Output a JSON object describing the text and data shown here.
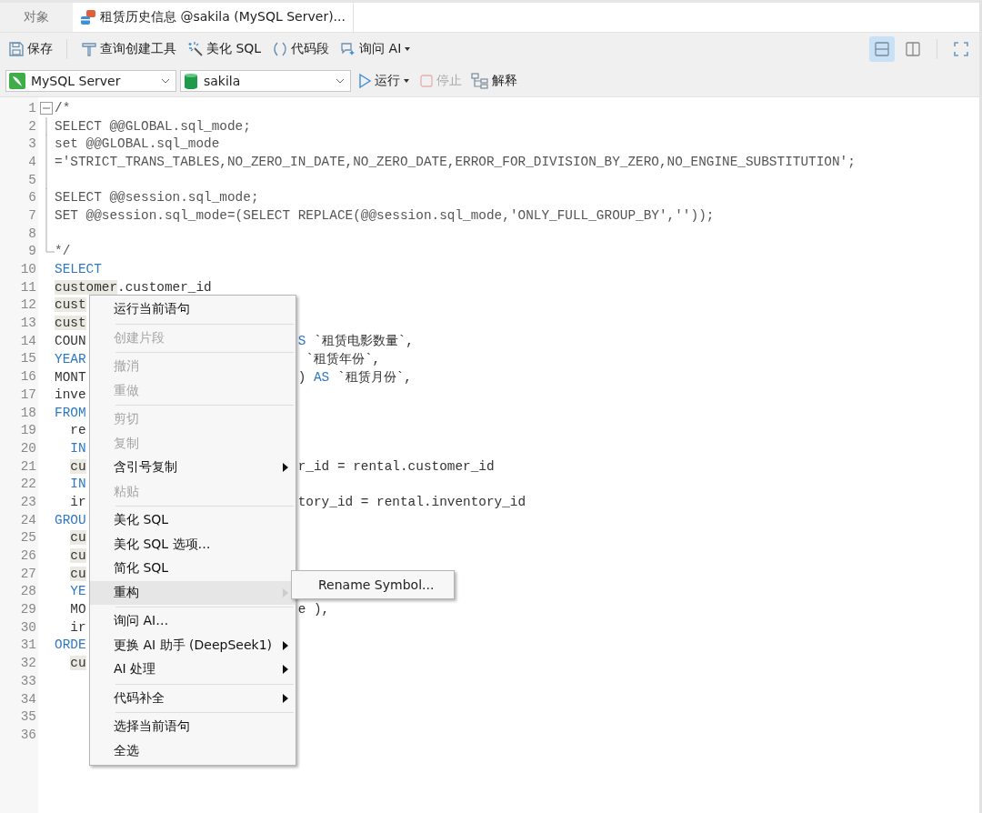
{
  "tabs": [
    {
      "kind": "objects",
      "label": "对象",
      "selected": false
    },
    {
      "kind": "query",
      "label": "租赁历史信息 @sakila (MySQL Server)...",
      "selected": true
    }
  ],
  "toolbar": [
    {
      "kind": "save",
      "label": "保存",
      "dropdown": false
    },
    {
      "kind": "query-builder",
      "label": "查询创建工具",
      "dropdown": false
    },
    {
      "kind": "beautify",
      "label": "美化 SQL",
      "dropdown": false
    },
    {
      "kind": "snippet",
      "label": "代码段",
      "dropdown": false
    },
    {
      "kind": "ask-ai",
      "label": "询问 AI",
      "dropdown": true
    }
  ],
  "view_buttons": [
    {
      "kind": "split-horizontal",
      "selected": true
    },
    {
      "kind": "split-vertical",
      "selected": false
    },
    {
      "kind": "fullscreen",
      "selected": false
    }
  ],
  "connection": {
    "value": "MySQL Server"
  },
  "database": {
    "value": "sakila"
  },
  "run_bar": [
    {
      "kind": "run",
      "label": "运行",
      "dropdown": true,
      "disabled": false
    },
    {
      "kind": "stop",
      "label": "停止",
      "dropdown": false,
      "disabled": true
    },
    {
      "kind": "explain",
      "label": "解释",
      "dropdown": false,
      "disabled": false
    }
  ],
  "editor": {
    "lines": [
      {
        "number": "1",
        "indent": false,
        "fold": {
          "kind": "start"
        },
        "code": [
          {
            "kind": "comment",
            "text": "/*"
          }
        ]
      },
      {
        "number": "2",
        "indent": false,
        "fold": {
          "kind": "middle"
        },
        "code": [
          {
            "kind": "comment",
            "text": "SELECT @@GLOBAL.sql_mode;"
          }
        ]
      },
      {
        "number": "3",
        "indent": false,
        "fold": {
          "kind": "middle"
        },
        "code": [
          {
            "kind": "comment",
            "text": "set @@GLOBAL.sql_mode"
          }
        ]
      },
      {
        "number": "4",
        "indent": false,
        "fold": {
          "kind": "middle"
        },
        "code": [
          {
            "kind": "comment",
            "text": "='STRICT_TRANS_TABLES,NO_ZERO_IN_DATE,NO_ZERO_DATE,ERROR_FOR_DIVISION_BY_ZERO,NO_ENGINE_SUBSTITUTION';"
          }
        ]
      },
      {
        "number": "5",
        "fold": {
          "kind": "middle"
        }
      },
      {
        "number": "6",
        "indent": false,
        "fold": {
          "kind": "middle"
        },
        "code": [
          {
            "kind": "comment",
            "text": "SELECT @@session.sql_mode;"
          }
        ]
      },
      {
        "number": "7",
        "indent": false,
        "fold": {
          "kind": "middle"
        },
        "code": [
          {
            "kind": "comment",
            "text": "SET @@session.sql_mode=(SELECT REPLACE(@@session.sql_mode,'ONLY_FULL_GROUP_BY',''));"
          }
        ]
      },
      {
        "number": "8",
        "fold": {
          "kind": "middle"
        }
      },
      {
        "number": "9",
        "indent": false,
        "fold": {
          "kind": "end"
        },
        "code": [
          {
            "kind": "comment",
            "text": "*/"
          }
        ]
      },
      {
        "number": "10",
        "indent": false,
        "code": [
          {
            "kind": "keyword",
            "text": "SELECT"
          }
        ]
      },
      {
        "number": "11",
        "indent": false,
        "code": [
          {
            "kind": "match",
            "text": "customer"
          },
          {
            "kind": "plain",
            "text": ".customer_id"
          }
        ]
      },
      {
        "number": "12",
        "indent": false,
        "code": [
          {
            "kind": "match",
            "text": "cust"
          }
        ]
      },
      {
        "number": "13",
        "indent": false,
        "code": [
          {
            "kind": "match",
            "text": "cust"
          }
        ]
      },
      {
        "number": "14",
        "indent": false,
        "code": [
          {
            "kind": "plain",
            "text": "COUN"
          }
        ],
        "tail": [
          {
            "kind": "keyword",
            "text": "S"
          },
          {
            "kind": "plain",
            "text": " `租赁电影数量`,"
          }
        ]
      },
      {
        "number": "15",
        "indent": false,
        "code": [
          {
            "kind": "keyword",
            "text": "YEAR"
          }
        ],
        "tail": [
          {
            "kind": "plain",
            "text": " `租赁年份`,"
          }
        ]
      },
      {
        "number": "16",
        "indent": false,
        "code": [
          {
            "kind": "plain",
            "text": "MONT"
          }
        ],
        "tail": [
          {
            "kind": "plain",
            "text": ") "
          },
          {
            "kind": "keyword",
            "text": "AS"
          },
          {
            "kind": "plain",
            "text": " `租赁月份`,"
          }
        ]
      },
      {
        "number": "17",
        "indent": false,
        "code": [
          {
            "kind": "plain",
            "text": "inve"
          }
        ]
      },
      {
        "number": "18",
        "indent": false,
        "code": [
          {
            "kind": "keyword",
            "text": "FROM"
          }
        ]
      },
      {
        "number": "19",
        "indent": true,
        "code": [
          {
            "kind": "plain",
            "text": "re"
          }
        ]
      },
      {
        "number": "20",
        "indent": true,
        "code": [
          {
            "kind": "keyword",
            "text": "IN"
          }
        ]
      },
      {
        "number": "21",
        "indent": true,
        "code": [
          {
            "kind": "match",
            "text": "cu"
          }
        ],
        "tail": [
          {
            "kind": "plain",
            "text": "r_id = rental.customer_id"
          }
        ]
      },
      {
        "number": "22",
        "indent": true,
        "code": [
          {
            "kind": "keyword",
            "text": "IN"
          }
        ]
      },
      {
        "number": "23",
        "indent": true,
        "code": [
          {
            "kind": "plain",
            "text": "ir"
          }
        ],
        "tail": [
          {
            "kind": "plain",
            "text": "tory_id = rental.inventory_id"
          }
        ]
      },
      {
        "number": "24",
        "indent": false,
        "code": [
          {
            "kind": "keyword",
            "text": "GROU"
          }
        ]
      },
      {
        "number": "25",
        "indent": true,
        "code": [
          {
            "kind": "match",
            "text": "cu"
          }
        ]
      },
      {
        "number": "26",
        "indent": true,
        "code": [
          {
            "kind": "match",
            "text": "cu"
          }
        ]
      },
      {
        "number": "27",
        "indent": true,
        "code": [
          {
            "kind": "match",
            "text": "cu"
          }
        ]
      },
      {
        "number": "28",
        "indent": true,
        "code": [
          {
            "kind": "keyword",
            "text": "YE"
          }
        ]
      },
      {
        "number": "29",
        "indent": true,
        "code": [
          {
            "kind": "plain",
            "text": "MO"
          }
        ],
        "tail": [
          {
            "kind": "plain",
            "text": "e ),"
          }
        ]
      },
      {
        "number": "30",
        "indent": true,
        "code": [
          {
            "kind": "plain",
            "text": "ir"
          }
        ]
      },
      {
        "number": "31",
        "indent": false,
        "code": [
          {
            "kind": "keyword",
            "text": "ORDE"
          }
        ]
      },
      {
        "number": "32",
        "indent": true,
        "code": [
          {
            "kind": "match",
            "text": "cu"
          }
        ]
      },
      {
        "number": "33"
      },
      {
        "number": "34"
      },
      {
        "number": "35"
      },
      {
        "number": "36"
      }
    ]
  },
  "context_menu": {
    "items": [
      {
        "kind": "item",
        "label": "运行当前语句",
        "disabled": false,
        "submenu": false,
        "selected": false
      },
      {
        "kind": "separator"
      },
      {
        "kind": "item",
        "label": "创建片段",
        "disabled": true,
        "submenu": false,
        "selected": false
      },
      {
        "kind": "separator"
      },
      {
        "kind": "item",
        "label": "撤消",
        "disabled": true,
        "submenu": false,
        "selected": false
      },
      {
        "kind": "item",
        "label": "重做",
        "disabled": true,
        "submenu": false,
        "selected": false
      },
      {
        "kind": "separator"
      },
      {
        "kind": "item",
        "label": "剪切",
        "disabled": true,
        "submenu": false,
        "selected": false
      },
      {
        "kind": "item",
        "label": "复制",
        "disabled": true,
        "submenu": false,
        "selected": false
      },
      {
        "kind": "item",
        "label": "含引号复制",
        "disabled": false,
        "submenu": true,
        "selected": false
      },
      {
        "kind": "item",
        "label": "粘贴",
        "disabled": true,
        "submenu": false,
        "selected": false
      },
      {
        "kind": "separator"
      },
      {
        "kind": "item",
        "label": "美化 SQL",
        "disabled": false,
        "submenu": false,
        "selected": false
      },
      {
        "kind": "item",
        "label": "美化 SQL 选项…",
        "disabled": false,
        "submenu": false,
        "selected": false
      },
      {
        "kind": "item",
        "label": "简化 SQL",
        "disabled": false,
        "submenu": false,
        "selected": false
      },
      {
        "kind": "item",
        "label": "重构",
        "disabled": false,
        "submenu": true,
        "selected": true
      },
      {
        "kind": "separator"
      },
      {
        "kind": "item",
        "label": "询问 AI…",
        "disabled": false,
        "submenu": false,
        "selected": false
      },
      {
        "kind": "item",
        "label": "更换 AI 助手 (DeepSeek1)",
        "disabled": false,
        "submenu": true,
        "selected": false
      },
      {
        "kind": "item",
        "label": "AI 处理",
        "disabled": false,
        "submenu": true,
        "selected": false
      },
      {
        "kind": "separator"
      },
      {
        "kind": "item",
        "label": "代码补全",
        "disabled": false,
        "submenu": true,
        "selected": false
      },
      {
        "kind": "separator"
      },
      {
        "kind": "item",
        "label": "选择当前语句",
        "disabled": false,
        "submenu": false,
        "selected": false
      },
      {
        "kind": "item",
        "label": "全选",
        "disabled": false,
        "submenu": false,
        "selected": false
      }
    ]
  },
  "submenu": {
    "items": [
      {
        "label": "Rename Symbol..."
      }
    ]
  }
}
